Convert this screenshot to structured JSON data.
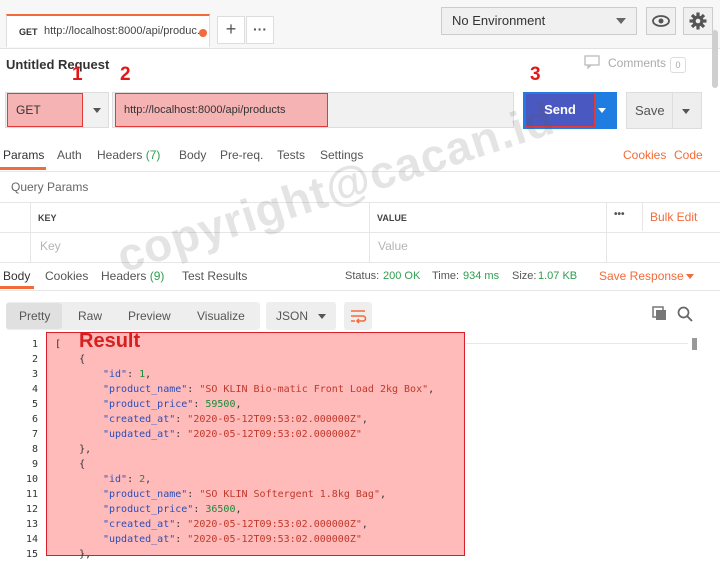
{
  "tab": {
    "method": "GET",
    "url": "http://localhost:8000/api/produc..."
  },
  "environment": {
    "selected": "No Environment"
  },
  "request": {
    "title": "Untitled Request",
    "comments_label": "Comments",
    "comments_count": "0",
    "method": "GET",
    "url": "http://localhost:8000/api/products",
    "send_label": "Send",
    "save_label": "Save"
  },
  "annotations": {
    "a1": "1",
    "a2": "2",
    "a3": "3",
    "result": "Result"
  },
  "request_tabs": {
    "params": "Params",
    "auth": "Auth",
    "headers": "Headers",
    "headers_count": "(7)",
    "body": "Body",
    "prereq": "Pre-req.",
    "tests": "Tests",
    "settings": "Settings",
    "cookies": "Cookies",
    "code": "Code"
  },
  "query_params": {
    "label": "Query Params",
    "key_header": "KEY",
    "value_header": "VALUE",
    "more": "•••",
    "bulk_edit": "Bulk Edit",
    "key_placeholder": "Key",
    "value_placeholder": "Value"
  },
  "response_tabs": {
    "body": "Body",
    "cookies": "Cookies",
    "headers": "Headers",
    "headers_count": "(9)",
    "test_results": "Test Results"
  },
  "response_stats": {
    "status_label": "Status:",
    "status_value": "200 OK",
    "time_label": "Time:",
    "time_value": "934 ms",
    "size_label": "Size:",
    "size_value": "1.07 KB",
    "save_response": "Save Response"
  },
  "view": {
    "pretty": "Pretty",
    "raw": "Raw",
    "preview": "Preview",
    "visualize": "Visualize",
    "format": "JSON"
  },
  "watermark": "copyright@cacan.id",
  "code_lines": [
    "1",
    "2",
    "3",
    "4",
    "5",
    "6",
    "7",
    "8",
    "9",
    "10",
    "11",
    "12",
    "13",
    "14",
    "15"
  ],
  "code": {
    "l1": "[",
    "l2": "    {",
    "l3k": "\"id\"",
    "l3v": "1",
    "l4k": "\"product_name\"",
    "l4v": "\"SO KLIN Bio-matic Front Load 2kg Box\"",
    "l5k": "\"product_price\"",
    "l5v": "59500",
    "l6k": "\"created_at\"",
    "l6v": "\"2020-05-12T09:53:02.000000Z\"",
    "l7k": "\"updated_at\"",
    "l7v": "\"2020-05-12T09:53:02.000000Z\"",
    "l8": "    },",
    "l9": "    {",
    "l10k": "\"id\"",
    "l10v": "2",
    "l11k": "\"product_name\"",
    "l11v": "\"SO KLIN Softergent 1.8kg Bag\"",
    "l12k": "\"product_price\"",
    "l12v": "36500",
    "l13k": "\"created_at\"",
    "l13v": "\"2020-05-12T09:53:02.000000Z\"",
    "l14k": "\"updated_at\"",
    "l14v": "\"2020-05-12T09:53:02.000000Z\"",
    "l15": "    },"
  }
}
